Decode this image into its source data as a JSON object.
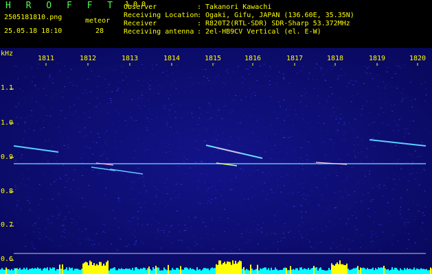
{
  "header": {
    "app_title": "H R O F F T",
    "app_version": "1.0.0",
    "filename": "2505181810.png",
    "datetime": "25.05.18 18:10",
    "meteor_label": "meteor",
    "meteor_count": "28"
  },
  "station": [
    {
      "key": "Observer",
      "value": ": Takanori Kawachi"
    },
    {
      "key": "Receiving Location",
      "value": ": Ogaki, Gifu, JAPAN (136.60E, 35.35N)"
    },
    {
      "key": "Receiver",
      "value": ": R820T2(RTL-SDR) SDR-Sharp 53.372MHz"
    },
    {
      "key": "Receiving antenna",
      "value": ": 2el-HB9CV Vertical (el. E-W)"
    }
  ],
  "spectrogram": {
    "y_unit": "kHz",
    "x_ticks": [
      "1811",
      "1812",
      "1813",
      "1814",
      "1815",
      "1816",
      "1817",
      "1818",
      "1819",
      "1820"
    ],
    "y_ticks": [
      "1.1",
      "1.0",
      "0.9",
      "0.8",
      "0.7",
      "0.6"
    ],
    "colors": {
      "background": "#0b0b6e",
      "text": "#ffff00",
      "carrier": "#5fd8ff",
      "bar": "#00ffff",
      "peak": "#ffff00"
    }
  }
}
